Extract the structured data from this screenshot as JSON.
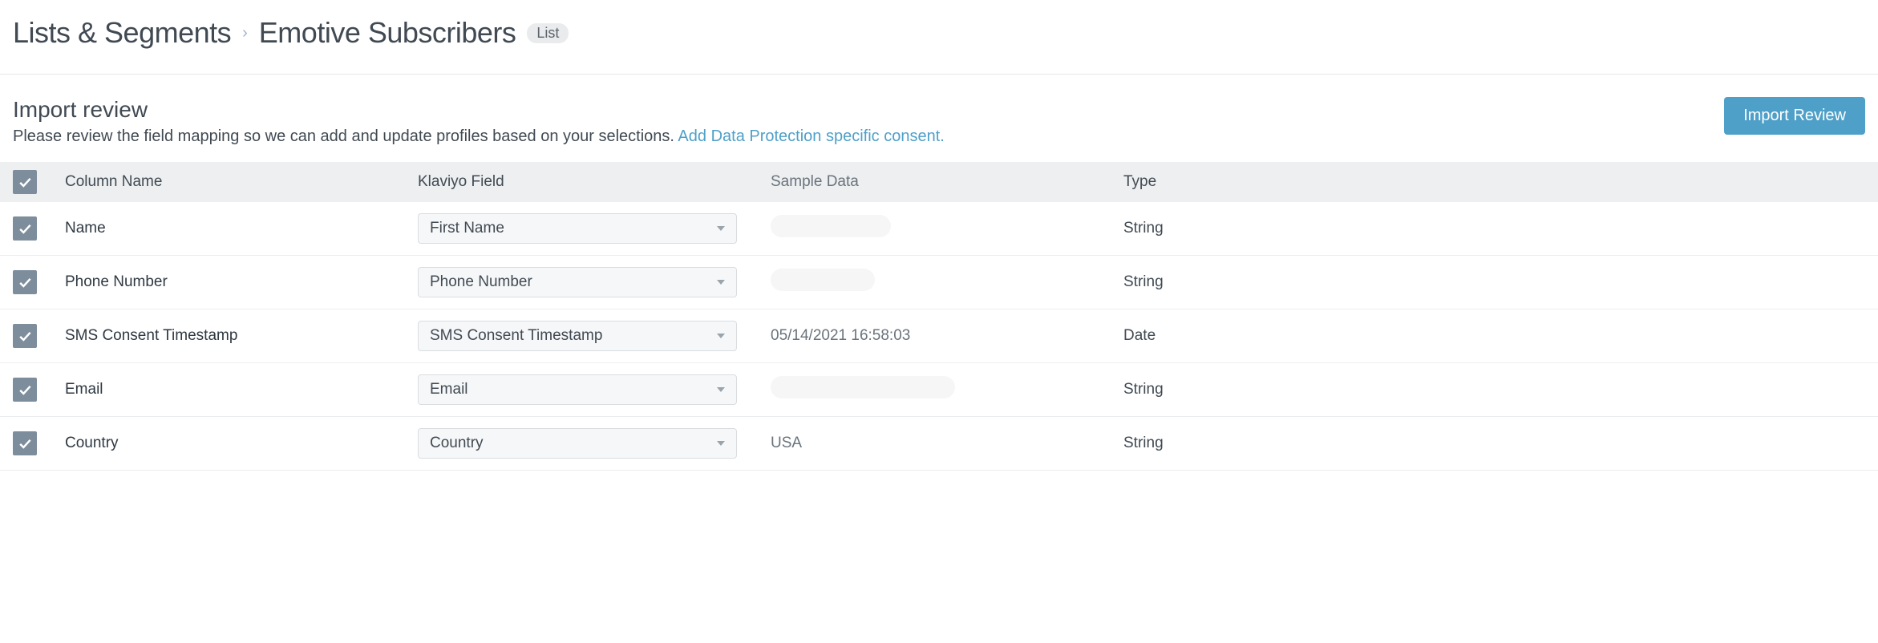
{
  "breadcrumb": {
    "root": "Lists & Segments",
    "current": "Emotive Subscribers",
    "badge": "List"
  },
  "section": {
    "title": "Import review",
    "description": "Please review the field mapping so we can add and update profiles based on your selections.",
    "link": "Add Data Protection specific consent.",
    "button": "Import Review"
  },
  "table": {
    "headers": {
      "column_name": "Column Name",
      "klaviyo_field": "Klaviyo Field",
      "sample_data": "Sample Data",
      "type": "Type"
    },
    "rows": [
      {
        "checked": true,
        "name": "Name",
        "field": "First Name",
        "sample": "",
        "redact": "w1",
        "type": "String"
      },
      {
        "checked": true,
        "name": "Phone Number",
        "field": "Phone Number",
        "sample": "",
        "redact": "w2",
        "type": "String"
      },
      {
        "checked": true,
        "name": "SMS Consent Timestamp",
        "field": "SMS Consent Timestamp",
        "sample": "05/14/2021 16:58:03",
        "redact": "",
        "type": "Date"
      },
      {
        "checked": true,
        "name": "Email",
        "field": "Email",
        "sample": "",
        "redact": "w3",
        "type": "String"
      },
      {
        "checked": true,
        "name": "Country",
        "field": "Country",
        "sample": "USA",
        "redact": "",
        "type": "String"
      }
    ]
  }
}
